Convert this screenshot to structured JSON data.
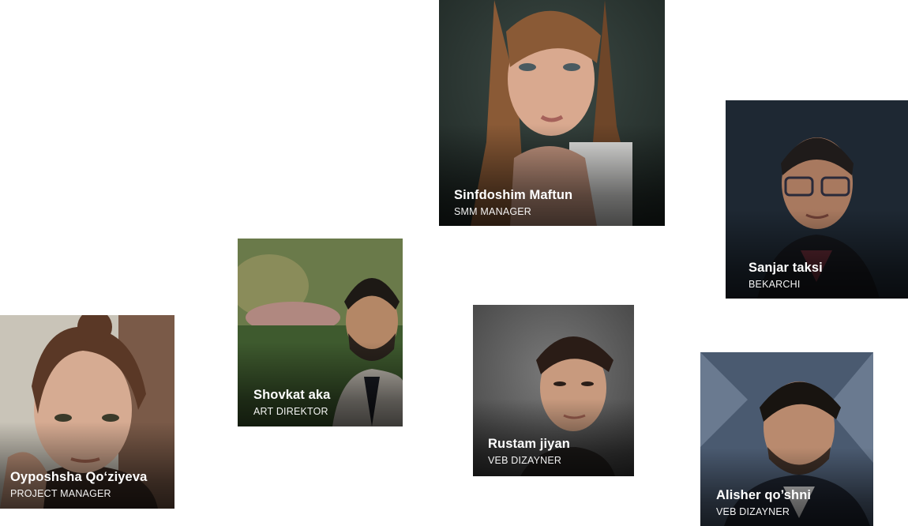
{
  "team": [
    {
      "name": "Sinfdoshim Maftun",
      "role": "SMM MANAGER",
      "photo": "portrait-woman-long-hair"
    },
    {
      "name": "Sanjar taksi",
      "role": "BEKARCHI",
      "photo": "portrait-man-glasses"
    },
    {
      "name": "Shovkat aka",
      "role": "ART DIREKTOR",
      "photo": "portrait-man-suit-beard"
    },
    {
      "name": "Rustam jiyan",
      "role": "VEB DIZAYNER",
      "photo": "portrait-young-man"
    },
    {
      "name": "Oyposhsha Qo‘ziyeva",
      "role": "PROJECT MANAGER",
      "photo": "portrait-woman-freckles"
    },
    {
      "name": "Alisher qo’shni",
      "role": "VEB DIZAYNER",
      "photo": "portrait-man-dark-hair"
    }
  ],
  "colors": {
    "background": "#ffffff",
    "caption_text": "#ffffff"
  }
}
